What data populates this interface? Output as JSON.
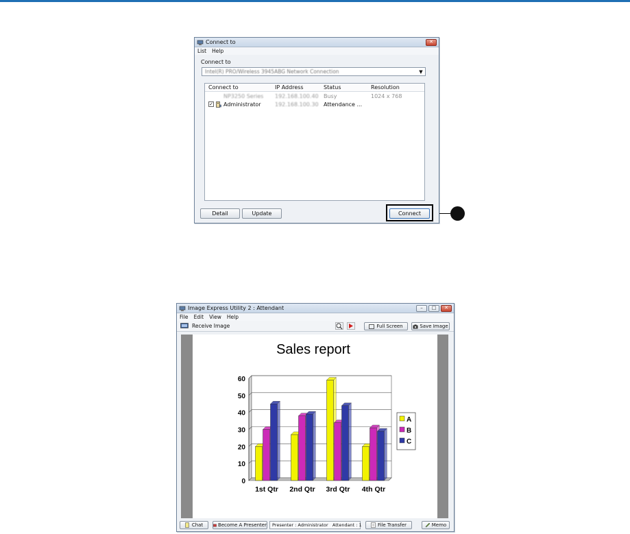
{
  "dialog": {
    "title": "Connect to",
    "menu": [
      "List",
      "Help"
    ],
    "section_label": "Connect to",
    "adapter_value": "Intel(R) PRO/Wireless 3945ABG Network Connection",
    "columns": [
      "Connect to",
      "IP Address",
      "Status",
      "Resolution"
    ],
    "rows": [
      {
        "name": "NP3250 Series",
        "ip": "192.168.100.40",
        "status": "Busy",
        "resolution": "1024 x 768"
      },
      {
        "name": "Administrator",
        "ip": "192.168.100.30",
        "status": "Attendance ...",
        "resolution": ""
      }
    ],
    "buttons": {
      "detail": "Detail",
      "update": "Update",
      "connect": "Connect"
    }
  },
  "app": {
    "title": "Image Express Utility 2 : Attendant",
    "menu": [
      "File",
      "Edit",
      "View",
      "Help"
    ],
    "toolbar": {
      "receive_image": "Receive Image",
      "full_screen": "Full Screen",
      "save_image": "Save Image"
    },
    "statusbar": {
      "chat": "Chat",
      "become_presenter": "Become A Presenter",
      "presenter_info": "Presenter : Administrator   Attendant : 1",
      "file_transfer": "File Transfer",
      "memo": "Memo"
    }
  },
  "chart_data": {
    "type": "bar",
    "title": "Sales report",
    "categories": [
      "1st Qtr",
      "2nd Qtr",
      "3rd Qtr",
      "4th Qtr"
    ],
    "series": [
      {
        "name": "A",
        "color": "#f2f200",
        "values": [
          20,
          27,
          59,
          20
        ]
      },
      {
        "name": "B",
        "color": "#cc2ab8",
        "values": [
          30,
          38,
          34,
          31
        ]
      },
      {
        "name": "C",
        "color": "#2f3aa6",
        "values": [
          45,
          39,
          44,
          29
        ]
      }
    ],
    "yticks": [
      0,
      10,
      20,
      30,
      40,
      50,
      60
    ],
    "ylim": [
      0,
      60
    ],
    "grid": true,
    "legend": "right"
  }
}
